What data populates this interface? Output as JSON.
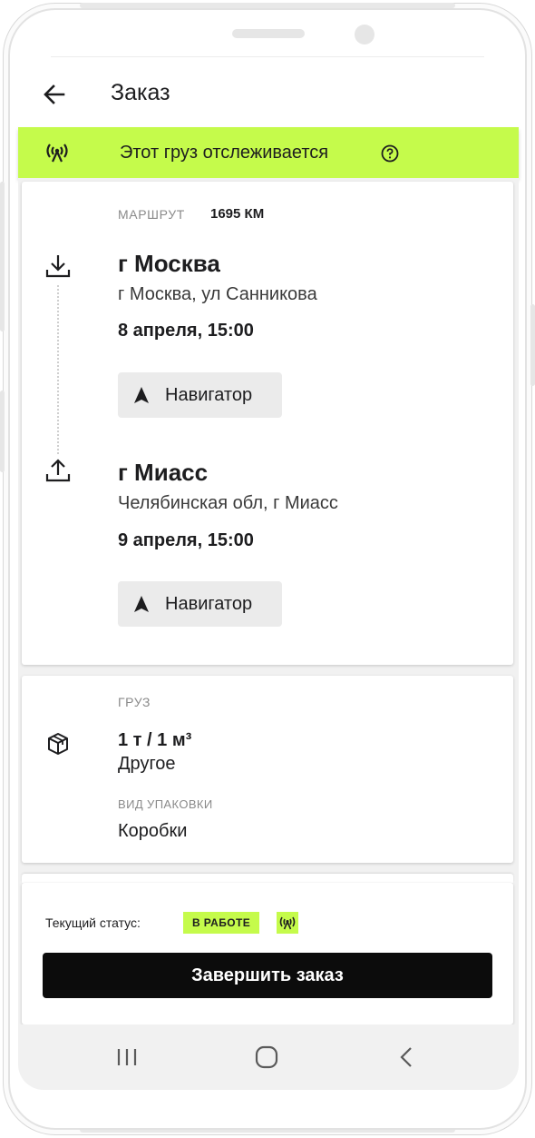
{
  "header": {
    "title": "Заказ"
  },
  "tracking_banner": {
    "text": "Этот груз отслеживается"
  },
  "route": {
    "label": "МАРШРУТ",
    "distance": "1695 КМ",
    "from": {
      "city": "г Москва",
      "address": "г Москва, ул Санникова",
      "datetime": "8 апреля, 15:00",
      "nav_label": "Навигатор"
    },
    "to": {
      "city": "г Миасс",
      "address": "Челябинская обл, г Миасс",
      "datetime": "9 апреля, 15:00",
      "nav_label": "Навигатор"
    }
  },
  "cargo": {
    "label": "ГРУЗ",
    "weight_volume": "1 т / 1 м³",
    "type": "Другое",
    "package_label": "ВИД УПАКОВКИ",
    "package_value": "Коробки"
  },
  "status": {
    "label": "Текущий статус:",
    "badge": "В РАБОТЕ",
    "complete_button": "Завершить заказ"
  },
  "colors": {
    "accent": "#c5fb4b",
    "primary_button": "#0c0c0c",
    "background": "#f1f1f1"
  },
  "icons": [
    "back-arrow-icon",
    "tracking-signal-icon",
    "help-icon",
    "download-icon",
    "upload-icon",
    "navigation-arrow-icon",
    "box-icon",
    "recent-apps-icon",
    "home-icon",
    "back-icon"
  ]
}
